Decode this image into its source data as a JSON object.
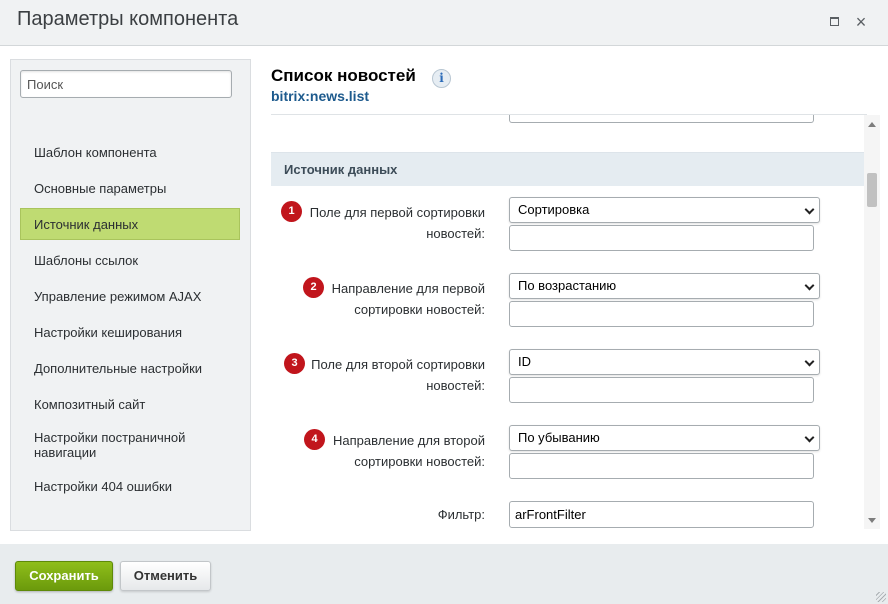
{
  "window": {
    "title": "Параметры компонента",
    "maximize_icon": "maximize-icon",
    "close_icon": "close-icon",
    "close_glyph": "×"
  },
  "sidebar": {
    "search_placeholder": "Поиск",
    "items": [
      {
        "label": "Шаблон компонента",
        "active": false
      },
      {
        "label": "Основные параметры",
        "active": false
      },
      {
        "label": "Источник данных",
        "active": true
      },
      {
        "label": "Шаблоны ссылок",
        "active": false
      },
      {
        "label": "Управление режимом AJAX",
        "active": false
      },
      {
        "label": "Настройки кеширования",
        "active": false
      },
      {
        "label": "Дополнительные настройки",
        "active": false
      },
      {
        "label": "Композитный сайт",
        "active": false
      },
      {
        "label": "Настройки постраничной навигации",
        "active": false
      },
      {
        "label": "Настройки 404 ошибки",
        "active": false
      }
    ]
  },
  "component": {
    "title": "Список новостей",
    "code": "bitrix:news.list",
    "info_glyph": "i"
  },
  "section": {
    "title": "Источник данных"
  },
  "fields": [
    {
      "badge": "1",
      "label_line1": "Поле для первой сортировки",
      "label_line2": "новостей:",
      "value": "Сортировка"
    },
    {
      "badge": "2",
      "label_line1": "Направление для первой",
      "label_line2": "сортировки новостей:",
      "value": "По возрастанию"
    },
    {
      "badge": "3",
      "label_line1": "Поле для второй сортировки",
      "label_line2": "новостей:",
      "value": "ID"
    },
    {
      "badge": "4",
      "label_line1": "Направление для второй",
      "label_line2": "сортировки новостей:",
      "value": "По убыванию"
    }
  ],
  "filter": {
    "label": "Фильтр:",
    "value": "arFrontFilter"
  },
  "footer": {
    "save_label": "Сохранить",
    "cancel_label": "Отменить"
  },
  "colors": {
    "active_nav": "#bfdb72",
    "badge": "#c1151c",
    "save_button": "#7aa912",
    "component_code": "#1d5a8d"
  }
}
